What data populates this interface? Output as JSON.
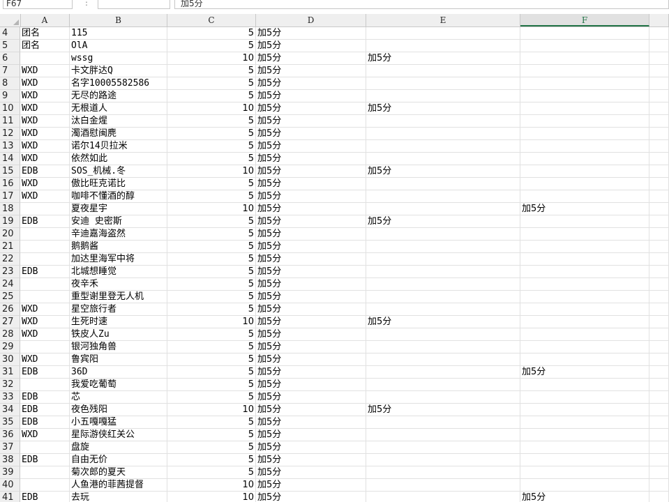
{
  "formula_bar": {
    "name_box": "F67",
    "formula": "加5分"
  },
  "columns": [
    "A",
    "B",
    "C",
    "D",
    "E",
    "F"
  ],
  "selected_column": "F",
  "rows": [
    {
      "n": "4",
      "a": "团名",
      "b": "115",
      "c": "5",
      "d": "加5分",
      "e": "",
      "f": ""
    },
    {
      "n": "5",
      "a": "团名",
      "b": "OlA",
      "c": "5",
      "d": "加5分",
      "e": "",
      "f": ""
    },
    {
      "n": "6",
      "a": "",
      "b": "wssg",
      "c": "10",
      "d": "加5分",
      "e": "加5分",
      "f": ""
    },
    {
      "n": "7",
      "a": "WXD",
      "b": "卡文胖达Q",
      "c": "5",
      "d": "加5分",
      "e": "",
      "f": ""
    },
    {
      "n": "8",
      "a": "WXD",
      "b": "名字10005582586",
      "c": "5",
      "d": "加5分",
      "e": "",
      "f": ""
    },
    {
      "n": "9",
      "a": "WXD",
      "b": "无尽的路途",
      "c": "5",
      "d": "加5分",
      "e": "",
      "f": ""
    },
    {
      "n": "10",
      "a": "WXD",
      "b": "无根道人",
      "c": "10",
      "d": "加5分",
      "e": "加5分",
      "f": ""
    },
    {
      "n": "11",
      "a": "WXD",
      "b": "汰白金煋",
      "c": "5",
      "d": "加5分",
      "e": "",
      "f": ""
    },
    {
      "n": "12",
      "a": "WXD",
      "b": "濁酒慰闽麂",
      "c": "5",
      "d": "加5分",
      "e": "",
      "f": ""
    },
    {
      "n": "13",
      "a": "WXD",
      "b": "诺尔14贝拉米",
      "c": "5",
      "d": "加5分",
      "e": "",
      "f": ""
    },
    {
      "n": "14",
      "a": "WXD",
      "b": "依然如此",
      "c": "5",
      "d": "加5分",
      "e": "",
      "f": ""
    },
    {
      "n": "15",
      "a": "EDB",
      "b": "SOS_机械.冬",
      "c": "10",
      "d": "加5分",
      "e": "加5分",
      "f": ""
    },
    {
      "n": "16",
      "a": "WXD",
      "b": "傲比旺克诺比",
      "c": "5",
      "d": "加5分",
      "e": "",
      "f": ""
    },
    {
      "n": "17",
      "a": "WXD",
      "b": "咖啡不懂酒的醇",
      "c": "5",
      "d": "加5分",
      "e": "",
      "f": ""
    },
    {
      "n": "18",
      "a": "",
      "b": "夏夜星宇",
      "c": "10",
      "d": "加5分",
      "e": "",
      "f": "加5分"
    },
    {
      "n": "19",
      "a": "EDB",
      "b": "安迪 史密斯",
      "c": "5",
      "d": "加5分",
      "e": "加5分",
      "f": ""
    },
    {
      "n": "20",
      "a": "",
      "b": "辛迪嘉海盗然",
      "c": "5",
      "d": "加5分",
      "e": "",
      "f": ""
    },
    {
      "n": "21",
      "a": "",
      "b": "鹅鹅酱",
      "c": "5",
      "d": "加5分",
      "e": "",
      "f": ""
    },
    {
      "n": "22",
      "a": "",
      "b": "加达里海军中将",
      "c": "5",
      "d": "加5分",
      "e": "",
      "f": ""
    },
    {
      "n": "23",
      "a": "EDB",
      "b": "北城想睡觉",
      "c": "5",
      "d": "加5分",
      "e": "",
      "f": ""
    },
    {
      "n": "24",
      "a": "",
      "b": "夜辛禾",
      "c": "5",
      "d": "加5分",
      "e": "",
      "f": ""
    },
    {
      "n": "25",
      "a": "",
      "b": "重型谢里登无人机",
      "c": "5",
      "d": "加5分",
      "e": "",
      "f": ""
    },
    {
      "n": "26",
      "a": "WXD",
      "b": "星空旅行者",
      "c": "5",
      "d": "加5分",
      "e": "",
      "f": ""
    },
    {
      "n": "27",
      "a": "WXD",
      "b": "生死时速",
      "c": "10",
      "d": "加5分",
      "e": "加5分",
      "f": ""
    },
    {
      "n": "28",
      "a": "WXD",
      "b": "铁皮人Zu",
      "c": "5",
      "d": "加5分",
      "e": "",
      "f": ""
    },
    {
      "n": "29",
      "a": "",
      "b": "银河独角兽",
      "c": "5",
      "d": "加5分",
      "e": "",
      "f": ""
    },
    {
      "n": "30",
      "a": "WXD",
      "b": "鲁宾阳",
      "c": "5",
      "d": "加5分",
      "e": "",
      "f": ""
    },
    {
      "n": "31",
      "a": "EDB",
      "b": "36D",
      "c": "5",
      "d": "加5分",
      "e": "",
      "f": "加5分"
    },
    {
      "n": "32",
      "a": "",
      "b": "我爱吃葡萄",
      "c": "5",
      "d": "加5分",
      "e": "",
      "f": ""
    },
    {
      "n": "33",
      "a": "EDB",
      "b": "芯",
      "c": "5",
      "d": "加5分",
      "e": "",
      "f": ""
    },
    {
      "n": "34",
      "a": "EDB",
      "b": "夜色残阳",
      "c": "10",
      "d": "加5分",
      "e": "加5分",
      "f": ""
    },
    {
      "n": "35",
      "a": "EDB",
      "b": "小五嘎嘎猛",
      "c": "5",
      "d": "加5分",
      "e": "",
      "f": ""
    },
    {
      "n": "36",
      "a": "WXD",
      "b": "星际游侠红关公",
      "c": "5",
      "d": "加5分",
      "e": "",
      "f": ""
    },
    {
      "n": "37",
      "a": "",
      "b": "盘旋",
      "c": "5",
      "d": "加5分",
      "e": "",
      "f": ""
    },
    {
      "n": "38",
      "a": "EDB",
      "b": "自由无价",
      "c": "5",
      "d": "加5分",
      "e": "",
      "f": ""
    },
    {
      "n": "39",
      "a": "",
      "b": "菊次郎的夏天",
      "c": "5",
      "d": "加5分",
      "e": "",
      "f": ""
    },
    {
      "n": "40",
      "a": "",
      "b": "人鱼港的菲茜提督",
      "c": "10",
      "d": "加5分",
      "e": "",
      "f": ""
    },
    {
      "n": "41",
      "a": "EDB",
      "b": "去玩",
      "c": "10",
      "d": "加5分",
      "e": "",
      "f": "加5分"
    }
  ]
}
